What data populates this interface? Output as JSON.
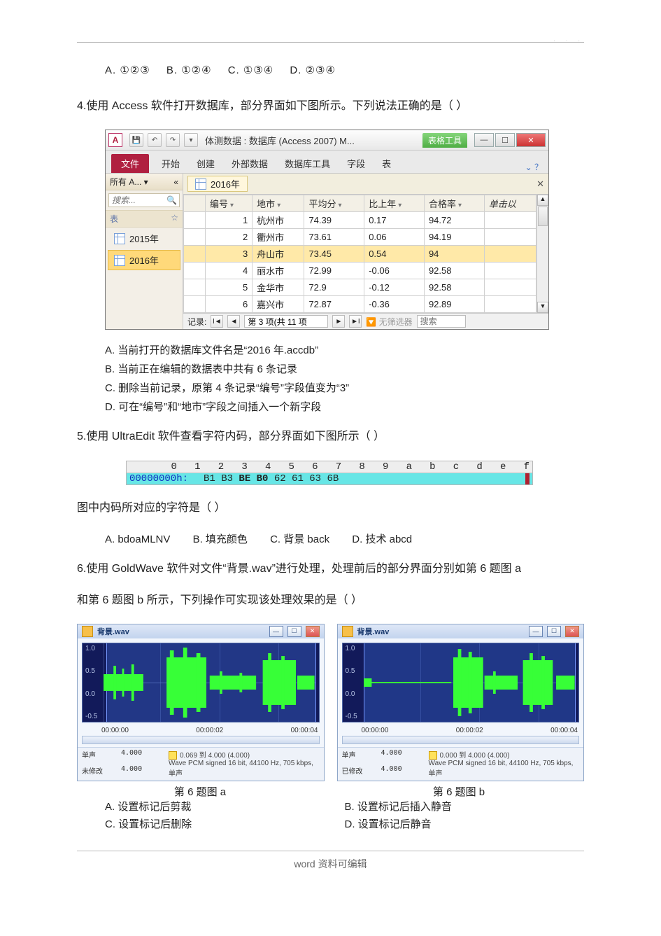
{
  "q3_options": {
    "a": "A.   ①②③",
    "b": "B.   ①②④",
    "c": "C.     ①③④",
    "d": "D.    ②③④"
  },
  "q4": {
    "text": "4.使用 Access 软件打开数据库，部分界面如下图所示。下列说法正确的是（     ）",
    "optA": "A.   当前打开的数据库文件名是“2016 年.accdb”",
    "optB": "B.   当前正在编辑的数据表中共有 6 条记录",
    "optC": "C.   删除当前记录，原第 4 条记录“编号”字段值变为“3”",
    "optD": "D.   可在“编号”和“地市”字段之间插入一个新字段"
  },
  "access": {
    "title": "体测数据 : 数据库 (Access 2007) M...",
    "tableTools": "表格工具",
    "ribbon": {
      "file": "文件",
      "home": "开始",
      "create": "创建",
      "external": "外部数据",
      "dbtools": "数据库工具",
      "fields": "字段",
      "table": "表"
    },
    "nav": {
      "header": "所有 A... ▾",
      "chevrons": "«",
      "searchPlaceholder": "搜索...",
      "group": "表",
      "groupChevron": "☆",
      "item1": "2015年",
      "item2": "2016年"
    },
    "objTab": "2016年",
    "headers": {
      "id": "编号",
      "city": "地市",
      "avg": "平均分",
      "delta": "比上年",
      "pass": "合格率",
      "add": "单击以"
    },
    "rows": [
      {
        "id": "1",
        "city": "杭州市",
        "avg": "74.39",
        "delta": "0.17",
        "pass": "94.72"
      },
      {
        "id": "2",
        "city": "衢州市",
        "avg": "73.61",
        "delta": "0.06",
        "pass": "94.19"
      },
      {
        "id": "3",
        "city": "舟山市",
        "avg": "73.45",
        "delta": "0.54",
        "pass": "94"
      },
      {
        "id": "4",
        "city": "丽水市",
        "avg": "72.99",
        "delta": "-0.06",
        "pass": "92.58"
      },
      {
        "id": "5",
        "city": "金华市",
        "avg": "72.9",
        "delta": "-0.12",
        "pass": "92.58"
      },
      {
        "id": "6",
        "city": "嘉兴市",
        "avg": "72.87",
        "delta": "-0.36",
        "pass": "92.89"
      }
    ],
    "recnav": {
      "label": "记录:",
      "pos": "第 3 项(共 11 项",
      "nofilter": "无筛选器",
      "search": "搜索"
    }
  },
  "q5": {
    "text": "5.使用 UltraEdit 软件查看字符内码，部分界面如下图所示（     ）",
    "text2": "图中内码所对应的字符是（     ）",
    "optA": "A.   bdoaMLNV",
    "optB": "B.   填充颜色",
    "optC": "C.   背景 back",
    "optD": "D.   技术 abcd"
  },
  "ue": {
    "ruler_cols": "0   1   2   3   4   5   6   7   8   9   a   b   c   d   e   f",
    "addr": "00000000h:",
    "hex_a": "B1 B3 ",
    "hex_b": "BE B0",
    "hex_c": " 62 61 63 6B"
  },
  "q6": {
    "text": "6.使用 GoldWave 软件对文件“背景.wav”进行处理，处理前后的部分界面分别如第 6 题图 a",
    "text_cont": "和第 6 题图 b 所示，下列操作可实现该处理效果的是（     ）",
    "capA": "第 6 题图 a",
    "capB": "第 6 题图 b",
    "optA": "A.   设置标记后剪裁",
    "optB": "B.   设置标记后插入静音",
    "optC": "C.   设置标记后删除",
    "optD": "D.   设置标记后静音"
  },
  "gw": {
    "filename": "背景.wav",
    "axis": [
      "1.0",
      "0.5",
      "0.0",
      "-0.5"
    ],
    "a": {
      "times": [
        "00:00:00",
        "",
        "00:00:02",
        "",
        "00:00:04"
      ],
      "mono_label": "单声",
      "mod_label": "未修改",
      "mono_val": "4.000",
      "mod_val": "4.000",
      "range": "0.069 到 4.000 (4.000)",
      "format": "Wave PCM signed 16 bit, 44100 Hz, 705 kbps, 单声"
    },
    "b": {
      "times": [
        "00:00:00",
        "",
        "00:00:02",
        "",
        "00:00:04"
      ],
      "mono_label": "单声",
      "mod_label": "已修改",
      "mono_val": "4.000",
      "mod_val": "4.000",
      "range": "0.000 到 4.000 (4.000)",
      "format": "Wave PCM signed 16 bit, 44100 Hz, 705 kbps, 单声"
    }
  },
  "footer": "word 资料可编辑"
}
